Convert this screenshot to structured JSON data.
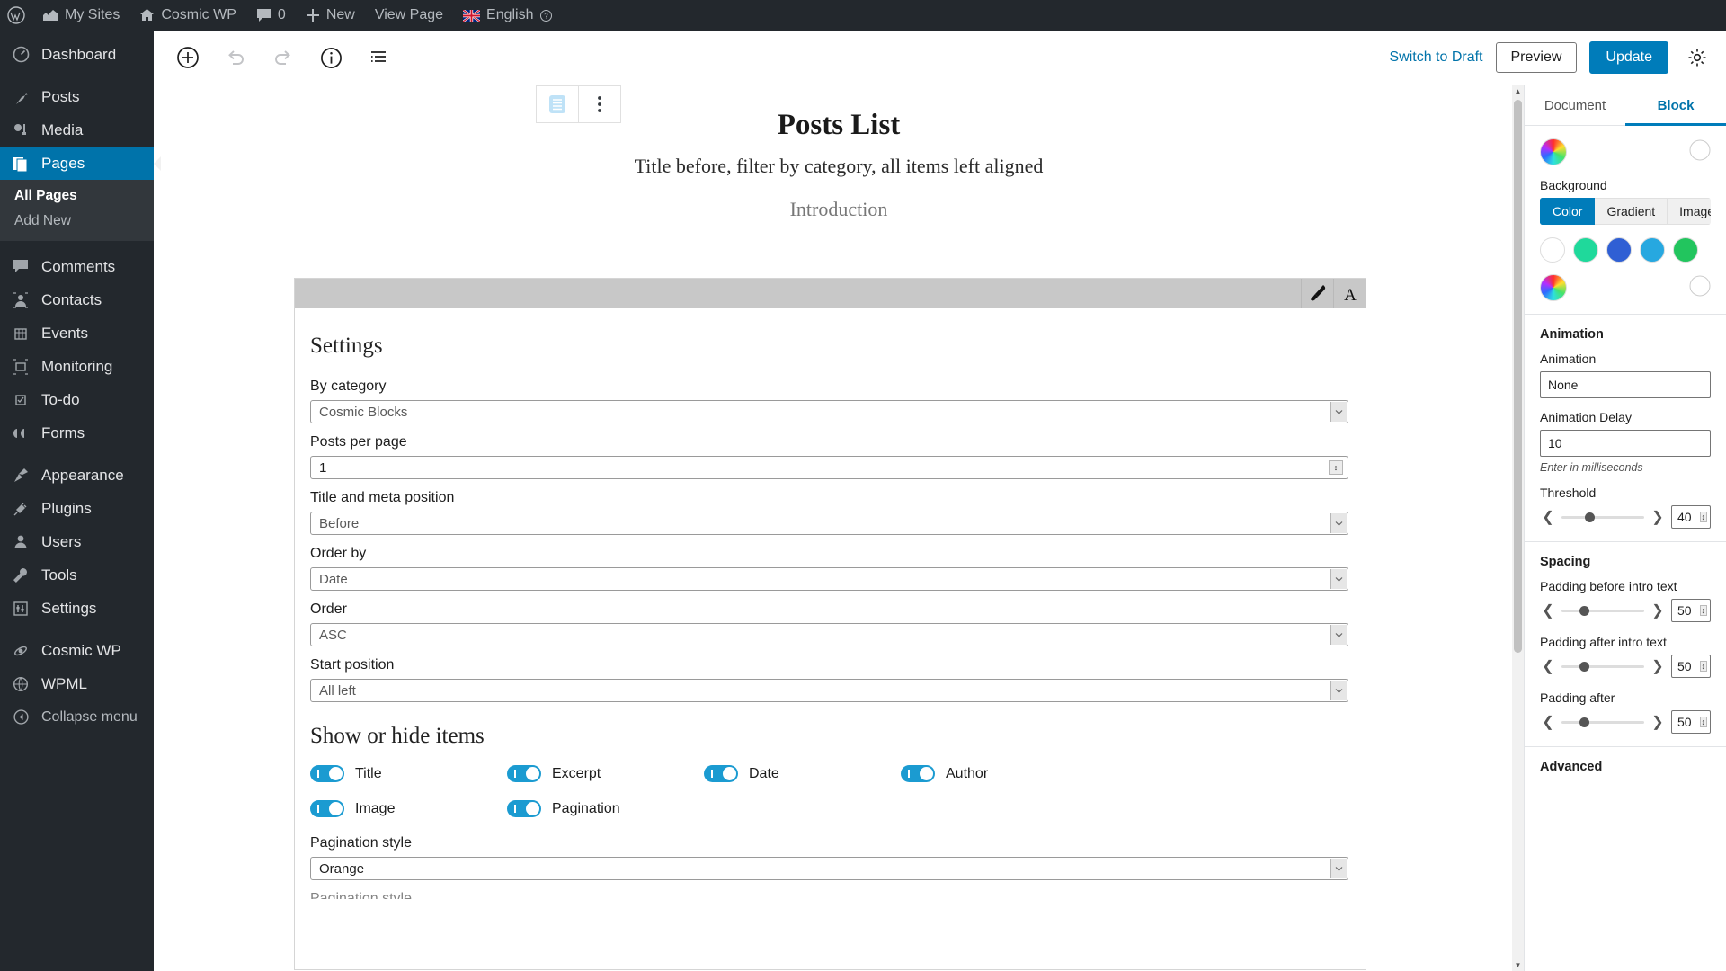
{
  "adminbar": {
    "items": [
      {
        "icon": "wordpress-logo-icon",
        "label": ""
      },
      {
        "icon": "sites-icon",
        "label": "My Sites"
      },
      {
        "icon": "home-icon",
        "label": "Cosmic WP"
      },
      {
        "icon": "comment-icon",
        "label": "0"
      },
      {
        "icon": "plus-icon",
        "label": "New"
      },
      {
        "icon": "",
        "label": "View Page"
      },
      {
        "icon": "uk-flag-icon",
        "label": "English"
      }
    ]
  },
  "adminmenu": {
    "items": [
      {
        "label": "Dashboard",
        "icon": "dashboard-icon",
        "current": false
      },
      {
        "label": "Posts",
        "icon": "pin-icon",
        "current": false
      },
      {
        "label": "Media",
        "icon": "media-icon",
        "current": false
      },
      {
        "label": "Pages",
        "icon": "pages-icon",
        "current": true
      },
      {
        "label": "Comments",
        "icon": "comment-icon",
        "current": false
      },
      {
        "label": "Contacts",
        "icon": "contacts-icon",
        "current": false
      },
      {
        "label": "Events",
        "icon": "events-icon",
        "current": false
      },
      {
        "label": "Monitoring",
        "icon": "monitoring-icon",
        "current": false
      },
      {
        "label": "To-do",
        "icon": "todo-icon",
        "current": false
      },
      {
        "label": "Forms",
        "icon": "forms-icon",
        "current": false
      },
      {
        "label": "Appearance",
        "icon": "appearance-icon",
        "current": false
      },
      {
        "label": "Plugins",
        "icon": "plugins-icon",
        "current": false
      },
      {
        "label": "Users",
        "icon": "users-icon",
        "current": false
      },
      {
        "label": "Tools",
        "icon": "tools-icon",
        "current": false
      },
      {
        "label": "Settings",
        "icon": "settings-icon",
        "current": false
      },
      {
        "label": "Cosmic WP",
        "icon": "cosmic-icon",
        "current": false
      },
      {
        "label": "WPML",
        "icon": "wpml-icon",
        "current": false
      }
    ],
    "submenu": [
      {
        "label": "All Pages",
        "active": true
      },
      {
        "label": "Add New",
        "active": false
      }
    ],
    "collapse_label": "Collapse menu"
  },
  "header": {
    "tools": [
      {
        "name": "add-block-icon"
      },
      {
        "name": "undo-icon"
      },
      {
        "name": "redo-icon"
      },
      {
        "name": "info-icon"
      },
      {
        "name": "list-view-icon"
      }
    ],
    "switch_to_draft": "Switch to Draft",
    "preview": "Preview",
    "update": "Update"
  },
  "canvas": {
    "block_toolbar": [
      {
        "name": "block-type-icon"
      },
      {
        "name": "more-options-icon"
      }
    ],
    "post_title": "Posts List",
    "post_subtitle": "Title before, filter by category, all items left aligned",
    "intro_text": "Introduction"
  },
  "blockframe": {
    "toolbar": [
      {
        "name": "brush-icon"
      },
      {
        "name": "typography-icon"
      }
    ],
    "settings_title": "Settings",
    "fields": [
      {
        "label": "By category",
        "value": "Cosmic Blocks",
        "type": "select"
      },
      {
        "label": "Posts per page",
        "value": "1",
        "type": "number"
      },
      {
        "label": "Title and meta position",
        "value": "Before",
        "type": "select"
      },
      {
        "label": "Order by",
        "value": "Date",
        "type": "select"
      },
      {
        "label": "Order",
        "value": "ASC",
        "type": "select"
      },
      {
        "label": "Start position",
        "value": "All left",
        "type": "select"
      }
    ],
    "toggles_title": "Show or hide items",
    "toggles": [
      {
        "label": "Title",
        "on": true
      },
      {
        "label": "Excerpt",
        "on": true
      },
      {
        "label": "Date",
        "on": true
      },
      {
        "label": "Author",
        "on": true
      },
      {
        "label": "Image",
        "on": true
      },
      {
        "label": "Pagination",
        "on": true
      }
    ],
    "pagination_style_label": "Pagination style",
    "pagination_style_value": "Orange",
    "cut_off_label": "Pagination style"
  },
  "sidebar": {
    "tabs": [
      {
        "label": "Document",
        "active": false
      },
      {
        "label": "Block",
        "active": true
      }
    ],
    "background_label": "Background",
    "bg_tabs": [
      {
        "label": "Color",
        "active": true
      },
      {
        "label": "Gradient",
        "active": false
      },
      {
        "label": "Image",
        "active": false
      }
    ],
    "swatches": [
      "#ffffff",
      "#1fd99b",
      "#2f5fd4",
      "#27a8e0",
      "#22c55e"
    ],
    "animation_section": "Animation",
    "animation_label": "Animation",
    "animation_value": "None",
    "animation_delay_label": "Animation Delay",
    "animation_delay_value": "10",
    "animation_delay_help": "Enter in milliseconds",
    "threshold_label": "Threshold",
    "threshold_value": "40",
    "spacing_section": "Spacing",
    "spacing_items": [
      {
        "label": "Padding before intro text",
        "value": "50"
      },
      {
        "label": "Padding after intro text",
        "value": "50"
      },
      {
        "label": "Padding after",
        "value": "50"
      }
    ],
    "advanced_section": "Advanced"
  },
  "colors": {
    "wp_blue": "#0073aa",
    "button_blue": "#007cba",
    "admin_dark": "#23282d",
    "toggle_on": "#1b9bd1"
  }
}
